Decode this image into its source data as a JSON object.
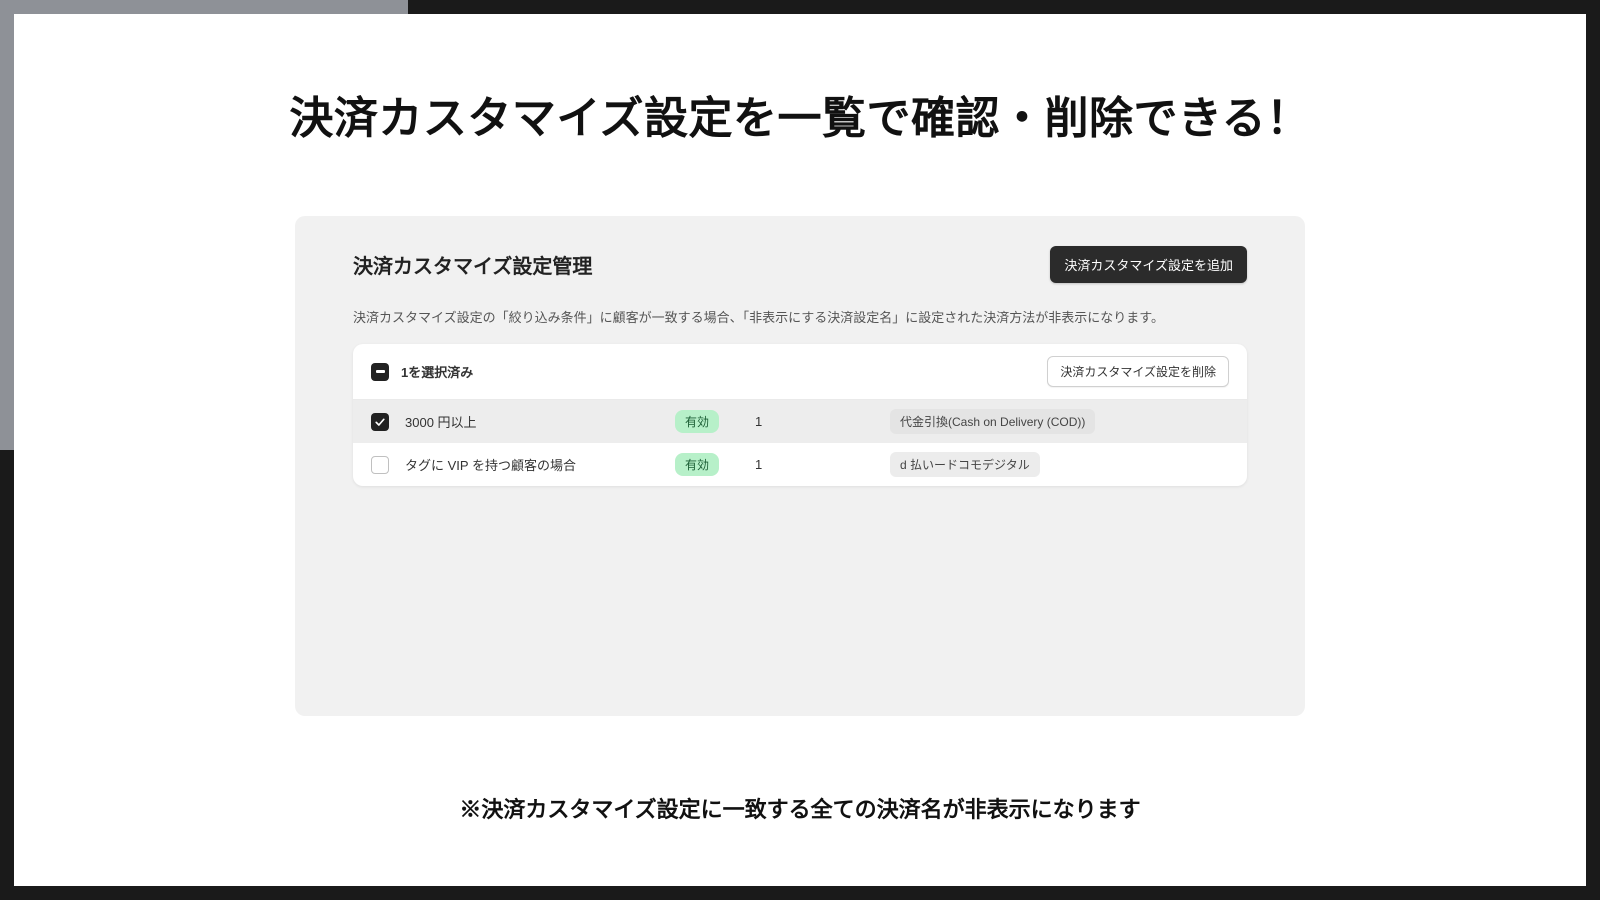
{
  "page": {
    "title": "決済カスタマイズ設定を一覧で確認・削除できる！",
    "footer_note": "※決済カスタマイズ設定に一致する全ての決済名が非表示になります"
  },
  "panel": {
    "title": "決済カスタマイズ設定管理",
    "add_button": "決済カスタマイズ設定を追加",
    "description": "決済カスタマイズ設定の「絞り込み条件」に顧客が一致する場合、「非表示にする決済設定名」に設定された決済方法が非表示になります。",
    "selection": {
      "count_text": "1を選択済み",
      "delete_button": "決済カスタマイズ設定を削除"
    },
    "rows": [
      {
        "checked": true,
        "name": "3000 円以上",
        "status": "有効",
        "count": "1",
        "payment": "代金引換(Cash on Delivery (COD))"
      },
      {
        "checked": false,
        "name": "タグに VIP を持つ顧客の場合",
        "status": "有効",
        "count": "1",
        "payment": "d 払いードコモデジタル"
      }
    ]
  }
}
